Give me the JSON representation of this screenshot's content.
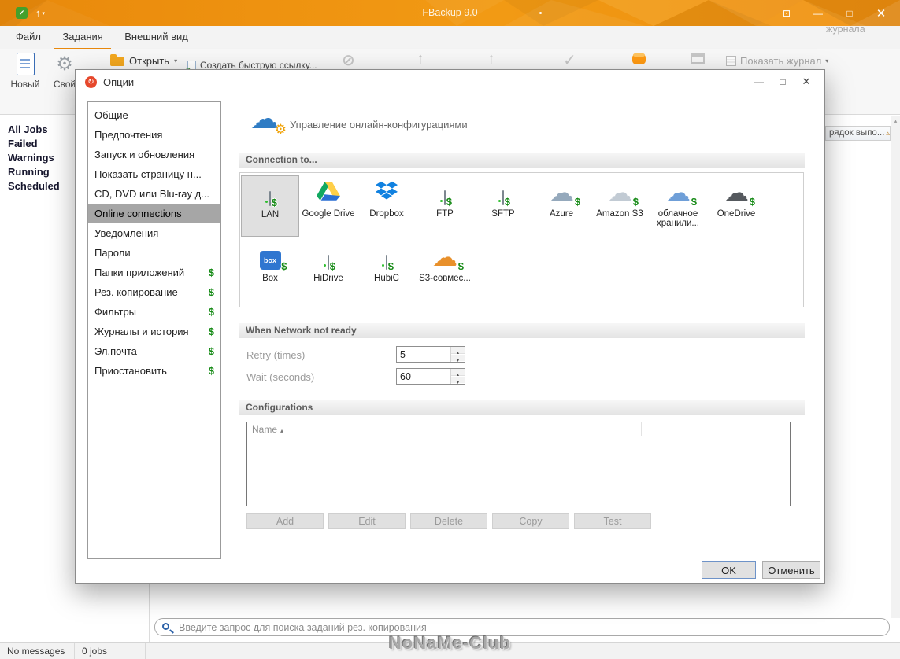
{
  "colors": {
    "titlebar_orange": "#ee8d10",
    "accent_orange": "#e8880c",
    "dollar_green": "#168a16"
  },
  "titlebar": {
    "title": "FBackup 9.0",
    "controls": {
      "fit": "⊡",
      "minimize": "—",
      "maximize": "□",
      "close": "✕"
    }
  },
  "tabs": [
    {
      "label": "Файл"
    },
    {
      "label": "Задания"
    },
    {
      "label": "Внешний вид"
    }
  ],
  "ribbon": {
    "new_label": "Новый",
    "properties_label": "Свой",
    "open_label": "Открыть",
    "open_caret": "▾",
    "quick_link_label": "Создать быструю ссылку...",
    "show_log_label": "Показать журнал",
    "show_log_caret": "▾",
    "log_partial": "журнала"
  },
  "jobs_panel": {
    "items": [
      {
        "label": "All Jobs"
      },
      {
        "label": "Failed"
      },
      {
        "label": "Warnings"
      },
      {
        "label": "Running"
      },
      {
        "label": "Scheduled"
      }
    ]
  },
  "list_header_partial": {
    "label": "рядок выпо...",
    "sort": "▵"
  },
  "dialog": {
    "title": "Опции",
    "icon_glyph": "↻",
    "controls": {
      "minimize": "—",
      "maximize": "□",
      "close": "✕"
    },
    "nav": [
      {
        "label": "Общие"
      },
      {
        "label": "Предпочтения"
      },
      {
        "label": "Запуск и обновления"
      },
      {
        "label": "Показать страницу н..."
      },
      {
        "label": "CD, DVD или Blu-ray д..."
      },
      {
        "label": "Online connections"
      },
      {
        "label": "Уведомления"
      },
      {
        "label": "Пароли"
      },
      {
        "label": "Папки приложений",
        "dollar": "$"
      },
      {
        "label": "Рез. копирование",
        "dollar": "$"
      },
      {
        "label": "Фильтры",
        "dollar": "$"
      },
      {
        "label": "Журналы и история",
        "dollar": "$"
      },
      {
        "label": "Эл.почта",
        "dollar": "$"
      },
      {
        "label": "Приостановить",
        "dollar": "$"
      }
    ],
    "header_text": "Управление онлайн-конфигурациями",
    "sections": {
      "connection": "Connection to...",
      "network": "When Network not ready",
      "configurations": "Configurations"
    },
    "dollar_glyph": "$",
    "connections": [
      {
        "label": "LAN",
        "icon": "network-drive"
      },
      {
        "label": "Google Drive",
        "icon": "google-drive"
      },
      {
        "label": "Dropbox",
        "icon": "dropbox"
      },
      {
        "label": "FTP",
        "icon": "ftp-server"
      },
      {
        "label": "SFTP",
        "icon": "sftp-server"
      },
      {
        "label": "Azure",
        "icon": "azure-cloud"
      },
      {
        "label": "Amazon S3",
        "icon": "amazon-s3-cloud"
      },
      {
        "label": "облачное хранили...",
        "icon": "generic-cloud"
      },
      {
        "label": "OneDrive",
        "icon": "onedrive-cloud"
      },
      {
        "label": "Box",
        "icon": "box"
      },
      {
        "label": "HiDrive",
        "icon": "hidrive-drive"
      },
      {
        "label": "HubiC",
        "icon": "hubic-drive"
      },
      {
        "label": "S3-совмес...",
        "icon": "s3-compatible-cloud"
      }
    ],
    "network": {
      "retry_label": "Retry (times)",
      "retry_value": "5",
      "wait_label": "Wait (seconds)",
      "wait_value": "60"
    },
    "table": {
      "column": "Name",
      "sort": "▴"
    },
    "config_buttons": [
      {
        "label": "Add"
      },
      {
        "label": "Edit"
      },
      {
        "label": "Delete"
      },
      {
        "label": "Copy"
      },
      {
        "label": "Test"
      }
    ],
    "ok_label": "OK",
    "cancel_label": "Отменить"
  },
  "search": {
    "placeholder": "Введите запрос для поиска заданий рез. копирования"
  },
  "statusbar": {
    "messages": "No messages",
    "jobs": "0 jobs"
  },
  "watermark": "NoNaMe-Club"
}
